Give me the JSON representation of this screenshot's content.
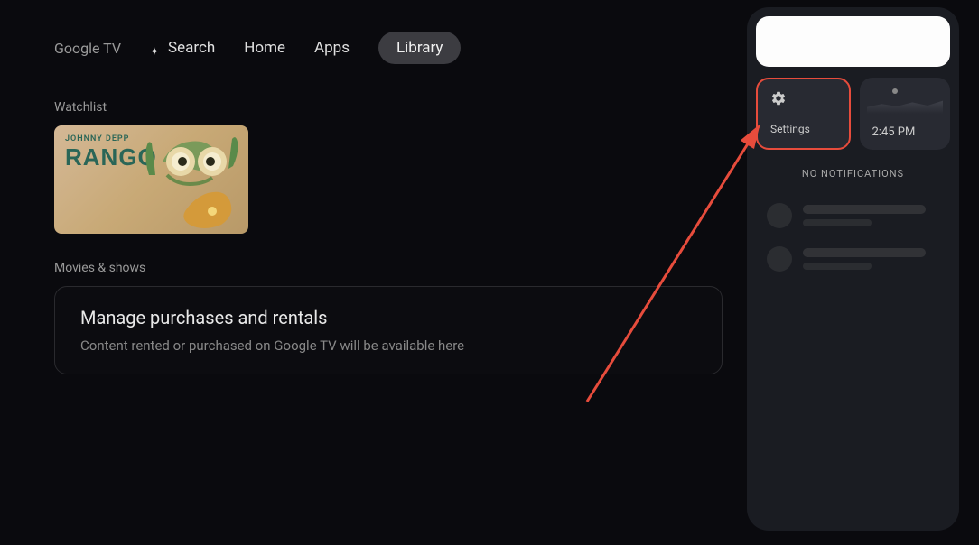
{
  "brand": "Google TV",
  "nav": {
    "search": "Search",
    "home": "Home",
    "apps": "Apps",
    "library": "Library"
  },
  "sections": {
    "watchlist_label": "Watchlist",
    "movies_label": "Movies & shows"
  },
  "movie": {
    "subtitle": "JOHNNY DEPP",
    "title": "RANGO"
  },
  "purchases": {
    "title": "Manage purchases and rentals",
    "description": "Content rented or purchased on Google TV will be available here"
  },
  "panel": {
    "settings_label": "Settings",
    "time": "2:45 PM",
    "no_notifications": "NO NOTIFICATIONS"
  }
}
